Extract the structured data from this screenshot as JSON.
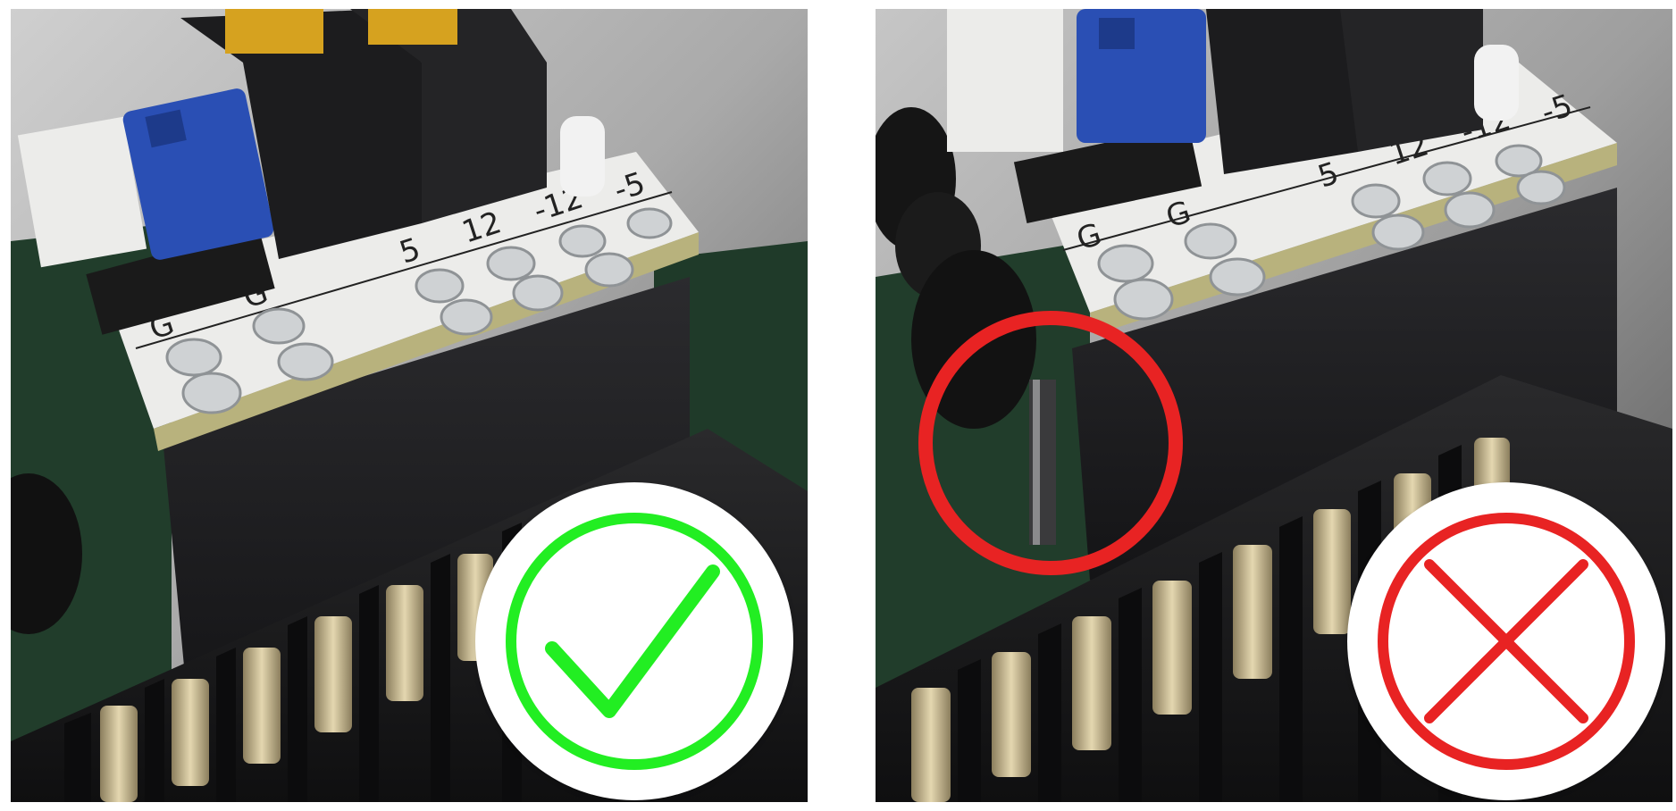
{
  "panels": [
    {
      "id": "correct",
      "verdict": "correct",
      "silkscreen": [
        "G",
        "G",
        "5",
        "12",
        "-12",
        "-5"
      ],
      "status_icon": "check-icon",
      "status_color": "#22ee22"
    },
    {
      "id": "incorrect",
      "verdict": "incorrect",
      "silkscreen": [
        "G",
        "G",
        "5",
        "12",
        "-12",
        "-5"
      ],
      "status_icon": "cross-icon",
      "status_color": "#e82323",
      "highlight": "misaligned-pin-circle"
    }
  ],
  "colors": {
    "pcb_green": "#1f3d2a",
    "jumper_blue": "#2a4fb4",
    "board_white": "#ececea",
    "connector_black": "#1b1b1d",
    "pin_gold": "#c9b27a"
  }
}
